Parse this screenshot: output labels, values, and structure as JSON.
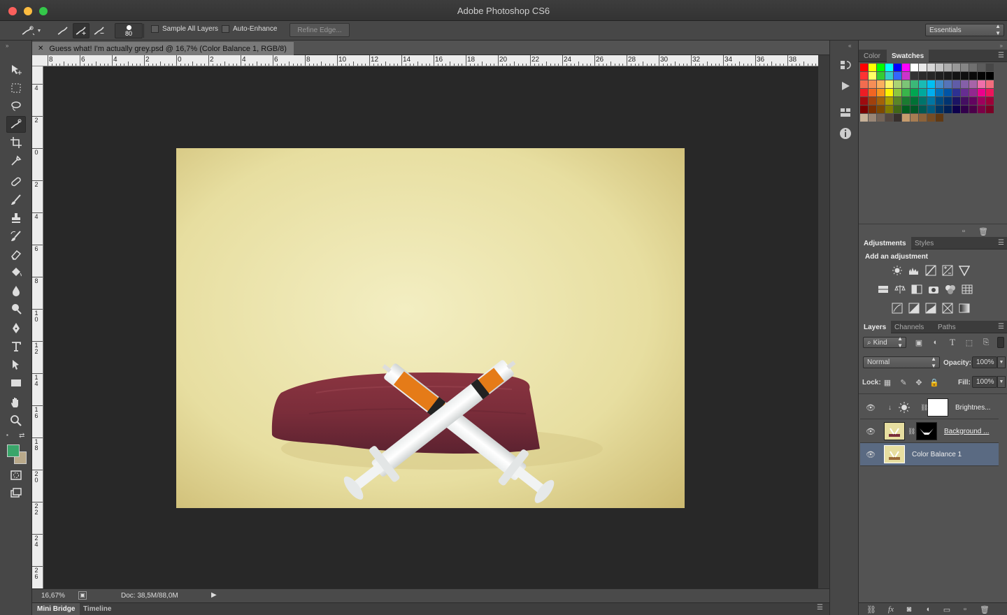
{
  "app": {
    "title": "Adobe Photoshop CS6",
    "workspace": "Essentials"
  },
  "options": {
    "brush_size": "80",
    "sample_all_layers": "Sample All Layers",
    "auto_enhance": "Auto-Enhance",
    "refine_edge": "Refine Edge..."
  },
  "document": {
    "tab_title": "Guess what! I'm actually grey.psd @ 16,7% (Color Balance 1, RGB/8)",
    "zoom": "16,67%",
    "doc_size": "Doc: 38,5M/88,0M"
  },
  "rulers": {
    "horizontal": [
      "8",
      "6",
      "4",
      "2",
      "0",
      "2",
      "4",
      "6",
      "8",
      "10",
      "12",
      "14",
      "16",
      "18",
      "20",
      "22",
      "24",
      "26",
      "28",
      "30",
      "32",
      "34",
      "36",
      "38"
    ],
    "vertical": [
      "4",
      "2",
      "0",
      "2",
      "4",
      "6",
      "8",
      "1 0",
      "1 2",
      "1 4",
      "1 6",
      "1 8",
      "2 0",
      "2 2",
      "2 4",
      "2 6"
    ]
  },
  "bottom_tabs": {
    "mini_bridge": "Mini Bridge",
    "timeline": "Timeline"
  },
  "panels": {
    "color_tab": "Color",
    "swatches_tab": "Swatches",
    "adjustments_tab": "Adjustments",
    "styles_tab": "Styles",
    "add_adjustment": "Add an adjustment",
    "layers_tab": "Layers",
    "channels_tab": "Channels",
    "paths_tab": "Paths",
    "kind": "Kind",
    "blend_mode": "Normal",
    "opacity_label": "Opacity:",
    "opacity_value": "100%",
    "lock_label": "Lock:",
    "fill_label": "Fill:",
    "fill_value": "100%"
  },
  "layers": [
    {
      "name": "Brightnes...",
      "visible": true,
      "selected": false
    },
    {
      "name": "Background ...",
      "visible": true,
      "selected": false
    },
    {
      "name": "Color Balance 1",
      "visible": true,
      "selected": true
    }
  ],
  "colors": {
    "foreground": "#3aa56a",
    "background": "#b9a98a",
    "photo_bg": "#ece6a8"
  },
  "swatch_rows": [
    [
      "#ff0000",
      "#ffff00",
      "#00ff00",
      "#00ffff",
      "#0000ff",
      "#ff00ff",
      "#ffffff",
      "#ebebeb",
      "#d6d6d6",
      "#c2c2c2",
      "#adadad",
      "#999999",
      "#858585",
      "#707070",
      "#5c5c5c",
      "#474747"
    ],
    [
      "#ff3333",
      "#ffff66",
      "#33cc33",
      "#33cccc",
      "#3366ff",
      "#cc33cc",
      "#333333",
      "#2b2b2b",
      "#262626",
      "#1f1f1f",
      "#1a1a1a",
      "#141414",
      "#0f0f0f",
      "#0a0a0a",
      "#050505",
      "#000000"
    ],
    [
      "#f26c4f",
      "#f68e56",
      "#fbaf5d",
      "#fff568",
      "#acd373",
      "#7cc576",
      "#3bb878",
      "#1abbb4",
      "#00bff3",
      "#438ccb",
      "#5574b9",
      "#605ca8",
      "#855fa8",
      "#a763a8",
      "#f06ea9",
      "#f26d7d"
    ],
    [
      "#ed1c24",
      "#f26522",
      "#f7941d",
      "#fff200",
      "#8dc63f",
      "#39b54a",
      "#00a651",
      "#00a99d",
      "#00aeef",
      "#0072bc",
      "#0054a6",
      "#2e3192",
      "#662d91",
      "#92278f",
      "#ec008c",
      "#ed145b"
    ],
    [
      "#9e0b0f",
      "#a0410d",
      "#a36209",
      "#aba000",
      "#598527",
      "#1a7b30",
      "#007236",
      "#00746b",
      "#0076a3",
      "#004a80",
      "#003471",
      "#1b1464",
      "#440e62",
      "#630460",
      "#9e005d",
      "#9e0039"
    ],
    [
      "#790000",
      "#7b2e00",
      "#7d4900",
      "#827b00",
      "#406618",
      "#005e20",
      "#005826",
      "#005952",
      "#005b7f",
      "#003663",
      "#002157",
      "#0d004c",
      "#32004b",
      "#4b0049",
      "#7b0046",
      "#7a0026"
    ],
    [
      "#c7b299",
      "#998675",
      "#736357",
      "#534741",
      "#37302d",
      "#c69c6d",
      "#a67c52",
      "#8c6239",
      "#754c24",
      "#603913"
    ]
  ]
}
